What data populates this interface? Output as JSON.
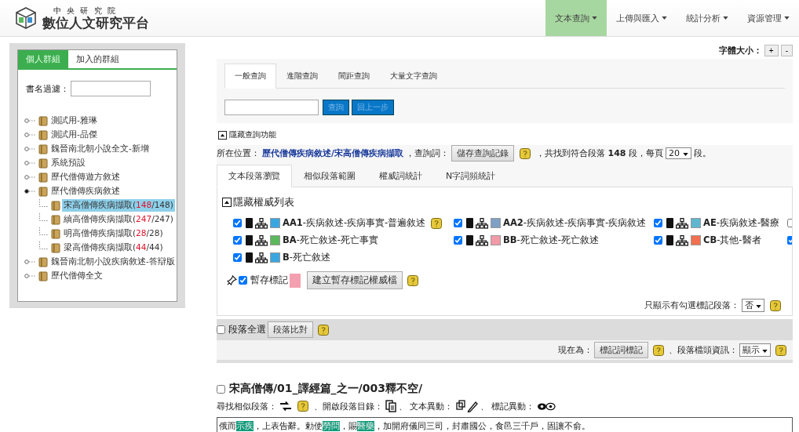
{
  "header": {
    "org": "中 央 研 究 院",
    "title": "數位人文研究平台",
    "menus": [
      {
        "label": "文本查詢",
        "selected": true
      },
      {
        "label": "上傳與匯入",
        "selected": false
      },
      {
        "label": "統計分析",
        "selected": false
      },
      {
        "label": "資源管理",
        "selected": false
      }
    ]
  },
  "sidebar": {
    "tabs": [
      {
        "label": "個人群組",
        "selected": true
      },
      {
        "label": "加入的群組",
        "selected": false
      }
    ],
    "filter_label": "書名過濾：",
    "tree": [
      {
        "label": "測試用-雅琳",
        "expanded": false,
        "selected": false
      },
      {
        "label": "測試用-品傑",
        "expanded": false,
        "selected": false
      },
      {
        "label": "魏晉南北朝小說全文-新增",
        "expanded": false,
        "selected": false
      },
      {
        "label": "系統預設",
        "expanded": false,
        "selected": false
      },
      {
        "label": "歷代僧傳遊方敘述",
        "expanded": false,
        "selected": false
      },
      {
        "label": "歷代僧傳疾病敘述",
        "expanded": true,
        "selected": false,
        "children": [
          {
            "label": "宋高僧傳疾病擷取(",
            "hits": "148",
            "total": "/148)",
            "selected": true
          },
          {
            "label": "續高僧傳疾病擷取(",
            "hits": "247",
            "total": "/247)",
            "selected": false
          },
          {
            "label": "明高僧傳疾病擷取(",
            "hits": "28",
            "total": "/28)",
            "selected": false
          },
          {
            "label": "梁高僧傳疾病擷取(",
            "hits": "44",
            "total": "/44)",
            "selected": false
          }
        ]
      },
      {
        "label": "魏晉南北朝小說疾病敘述-答辯版",
        "expanded": false,
        "selected": false
      },
      {
        "label": "歷代僧傳全文",
        "expanded": false,
        "selected": false
      }
    ]
  },
  "font_size": {
    "label": "字體大小：",
    "buttons": [
      "+",
      "-"
    ]
  },
  "query": {
    "tabs": [
      {
        "label": "一般查詢",
        "selected": true
      },
      {
        "label": "進階查詢",
        "selected": false
      },
      {
        "label": "間距查詢",
        "selected": false
      },
      {
        "label": "大量文字查詢",
        "selected": false
      }
    ],
    "buttons": [
      "查詢",
      "回上一步"
    ],
    "toggle": "隱藏查詢功能"
  },
  "location": {
    "label": "所在位置：",
    "path": "歷代僧傳疾病敘述/宋高僧傳疾病擷取",
    "query_label": "，查詢詞：",
    "save_button": "儲存查詢記錄",
    "found": "，共找到符合段落 **148** 段，每頁",
    "per_page": "20",
    "suffix": "段。"
  },
  "result_tabs": [
    {
      "label": "文本段落瀏覽",
      "selected": true
    },
    {
      "label": "相似段落範圍",
      "selected": false
    },
    {
      "label": "權威詞統計",
      "selected": false
    },
    {
      "label": "N字詞頻統計",
      "selected": false
    }
  ],
  "authority": {
    "toggle": "隱藏權威列表",
    "items": [
      {
        "kind": "full",
        "checked": true,
        "code": "AA1",
        "name": "-疾病敘述-疾病事實-普遍敘述",
        "color": "#3aa6e0",
        "help": true
      },
      {
        "kind": "full",
        "checked": true,
        "code": "AA2",
        "name": "-疾病敘述-疾病事實-疾病敘述",
        "color": "#7f9fc4",
        "help": false
      },
      {
        "kind": "full",
        "checked": true,
        "code": "AE",
        "name": "-疾病敘述-醫療",
        "color": "#5fb6cf",
        "help": false
      },
      {
        "kind": "cut",
        "checked": false
      },
      {
        "kind": "full",
        "checked": true,
        "code": "BA",
        "name": "-死亡敘述-死亡事實",
        "color": "#5cb85c",
        "help": false
      },
      {
        "kind": "full",
        "checked": true,
        "code": "BB",
        "name": "-死亡敘述-死亡敘述",
        "color": "#f19aa8",
        "help": false
      },
      {
        "kind": "full",
        "checked": true,
        "code": "CB",
        "name": "-其他-醫者",
        "color": "#f07050",
        "help": false
      },
      {
        "kind": "cut",
        "checked": true
      },
      {
        "kind": "full",
        "checked": true,
        "code": "B",
        "name": "-死亡敘述",
        "color": "#3aa6e0",
        "help": false
      }
    ],
    "temp": {
      "checked": true,
      "label": "暫存標記",
      "color": "#f4a0b0",
      "button": "建立暫存標記權威檔"
    },
    "only_label": "只顯示有勾選標記段落：",
    "only_value": "否"
  },
  "select_bar": {
    "checked": false,
    "label": "段落全選",
    "button": "段落比對"
  },
  "mode_bar": {
    "label": "現在為：",
    "button": "標記詞標記",
    "info_label": "、段落檔頭資訊：",
    "info_value": "顯示"
  },
  "passage": {
    "checked": false,
    "title": "宋高僧傳/01_譯經篇_之一/003釋不空/",
    "tools": [
      "尋找相似段落：",
      "、開啟段落目錄：",
      "、 文本異動：",
      "、 標記異動："
    ],
    "segments": [
      {
        "text": "俄而",
        "marked": false
      },
      {
        "text": "示疾",
        "marked": true
      },
      {
        "text": "，上表告辭。勅使",
        "marked": false
      },
      {
        "text": "勞問",
        "marked": true
      },
      {
        "text": "，賜",
        "marked": false
      },
      {
        "text": "醫藥",
        "marked": true
      },
      {
        "text": "，加開府儀同三司，封肅國公，食邑三千戶，固讓不俞。",
        "marked": false
      }
    ]
  }
}
